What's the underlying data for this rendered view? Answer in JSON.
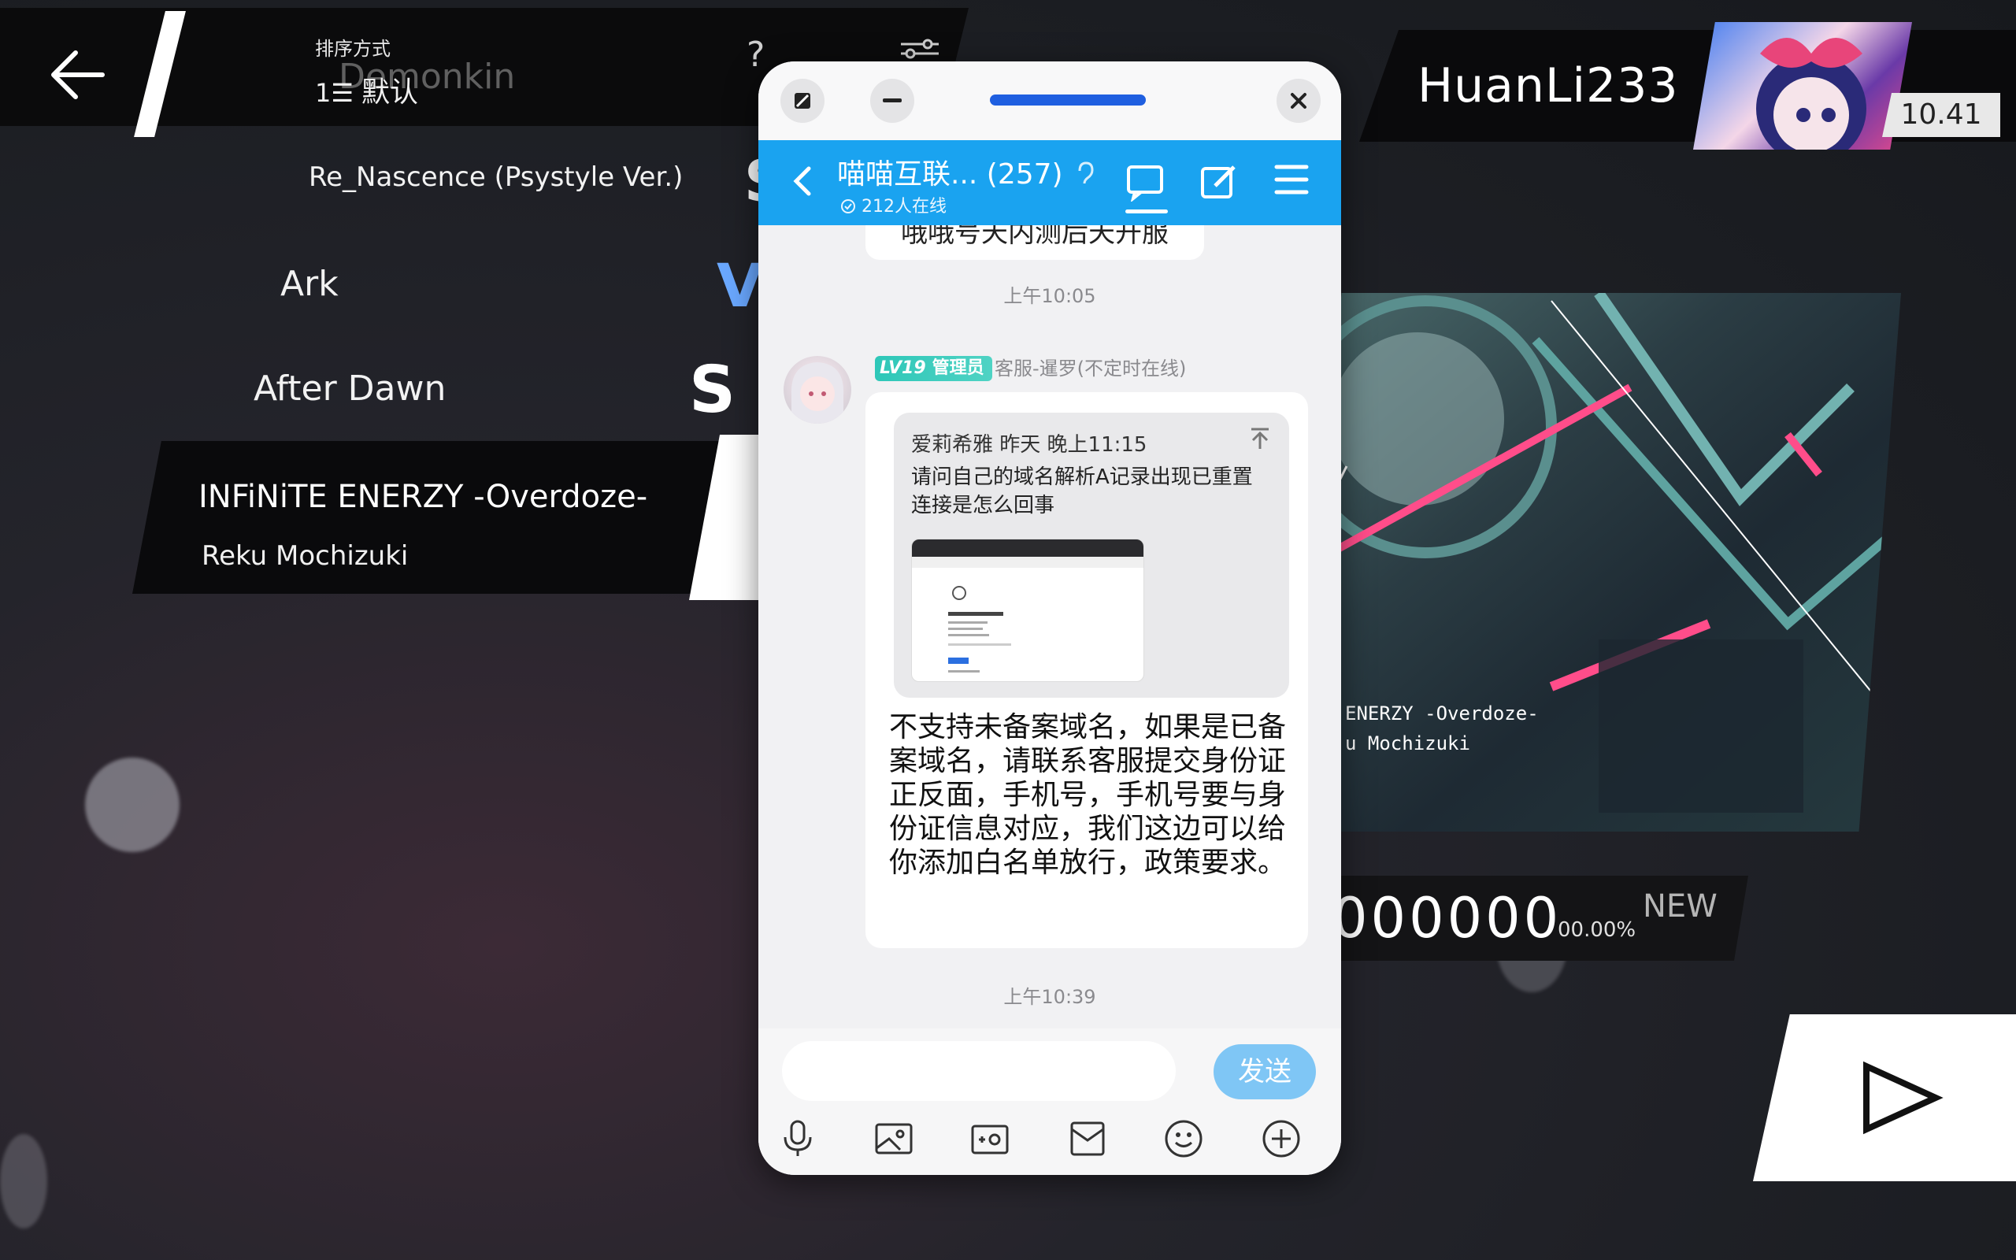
{
  "game": {
    "sort_label": "排序方式",
    "sort_icon": "1☰",
    "sort_value": "默认",
    "ghost_author": "Demonkin",
    "help_label": "?",
    "songs": [
      {
        "title": "Re_Nascence (Psystyle Ver.)",
        "glyph": "S"
      },
      {
        "title": "Ark",
        "glyph": "V"
      },
      {
        "title": "After Dawn",
        "glyph": "S"
      }
    ],
    "selected": {
      "title": "INFiNiTE ENERZY -Overdoze-",
      "artist": "Reku Mochizuki"
    },
    "player": {
      "name": "HuanLi233",
      "rating": "10.41"
    },
    "cover_text": {
      "line1": "ENERZY -Overdoze-",
      "line2": "u Mochizuki"
    },
    "score": {
      "value": "000000",
      "percent": "00.00%",
      "new_label": "NEW"
    }
  },
  "chat": {
    "group_name": "喵喵互联...",
    "member_count": "(257)",
    "online": "212人在线",
    "partial_message": "哦哦号天内测后天开服",
    "timestamp_1": "上午10:05",
    "badge_level": "LV19",
    "badge_role": "管理员",
    "sender": "客服-暹罗(不定时在线)",
    "quote": {
      "author_time": "爱莉希雅 昨天 晚上11:15",
      "text": "请问自己的域名解析A记录出现已重置连接是怎么回事"
    },
    "reply": "不支持未备案域名，如果是已备案域名，请联系客服提交身份证正反面，手机号，手机号要与身份证信息对应，我们这边可以给你添加白名单放行，政策要求。",
    "timestamp_2": "上午10:39",
    "input_placeholder": "",
    "send_label": "发送"
  },
  "colors": {
    "chat_header": "#1aa3f0",
    "send_button": "#7fc6f5",
    "admin_badge": "#2ec7b8",
    "game_panel": "#0b0b0c"
  },
  "icons": [
    "back-arrow-icon",
    "filter-sliders-icon",
    "help-icon",
    "play-icon",
    "float-toggle-icon",
    "minimize-icon",
    "close-icon",
    "chevron-left-icon",
    "ear-icon",
    "chat-bubble-icon",
    "edit-icon",
    "menu-icon",
    "pin-top-icon",
    "microphone-icon",
    "image-icon",
    "camera-icon",
    "envelope-icon",
    "emoji-icon",
    "plus-circle-icon"
  ]
}
